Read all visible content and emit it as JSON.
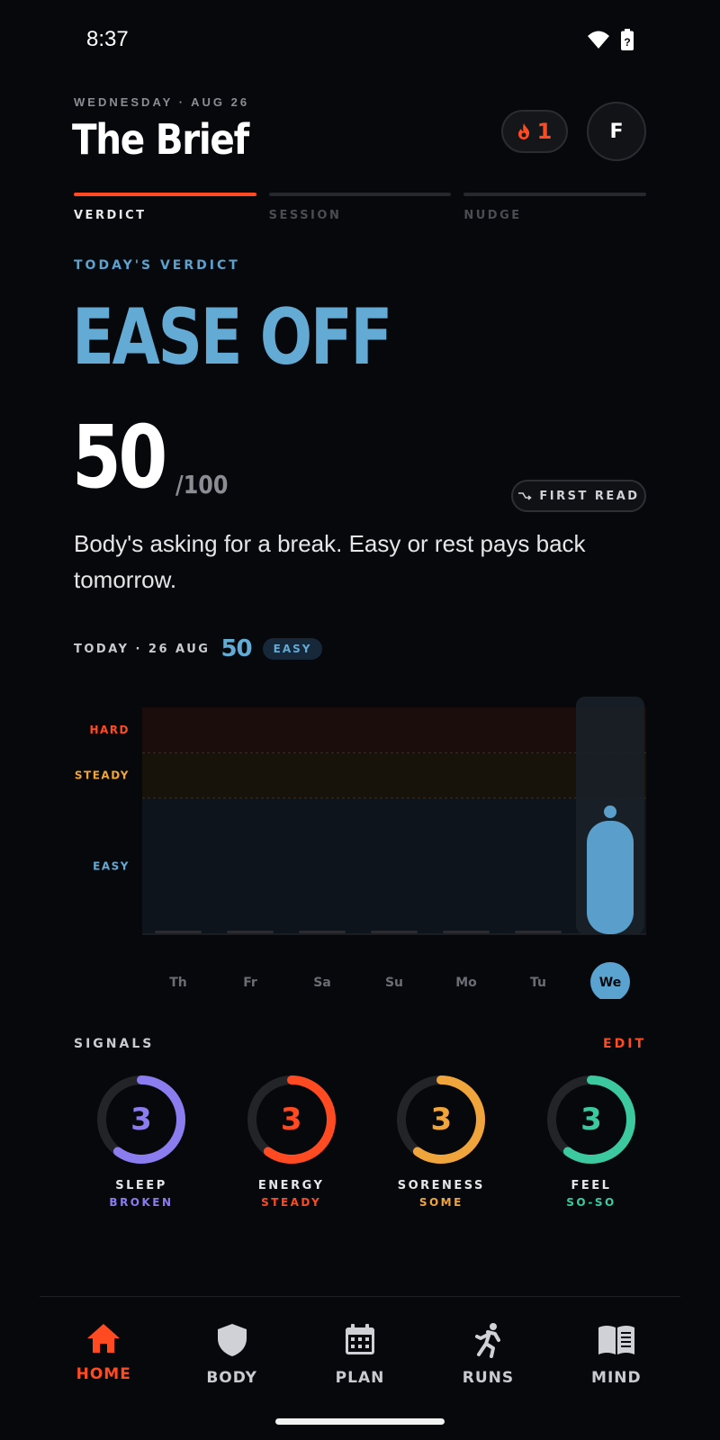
{
  "status": {
    "time": "8:37"
  },
  "header": {
    "date": "WEDNESDAY · AUG 26",
    "title": "The Brief",
    "streak_count": "1",
    "avatar_initial": "F"
  },
  "tabs": [
    {
      "label": "VERDICT",
      "active": true
    },
    {
      "label": "SESSION",
      "active": false
    },
    {
      "label": "NUDGE",
      "active": false
    }
  ],
  "verdict": {
    "label": "TODAY'S VERDICT",
    "headline": "EASE OFF",
    "score": "50",
    "score_max": "/100",
    "first_read_label": "FIRST READ",
    "summary": "Body's asking for a break. Easy or rest pays back tomorrow."
  },
  "today": {
    "label": "TODAY · 26 AUG",
    "score": "50",
    "pill": "EASY"
  },
  "chart_data": {
    "type": "bar",
    "categories": [
      "Th",
      "Fr",
      "Sa",
      "Su",
      "Mo",
      "Tu",
      "We"
    ],
    "values": [
      0,
      0,
      0,
      0,
      0,
      0,
      50
    ],
    "selected": "We",
    "ylim": [
      0,
      100
    ],
    "zones": [
      {
        "label": "HARD",
        "from": 80,
        "to": 100,
        "color": "#ff4a22"
      },
      {
        "label": "STEADY",
        "from": 60,
        "to": 80,
        "color": "#f0a53c"
      },
      {
        "label": "EASY",
        "from": 0,
        "to": 60,
        "color": "#63aad5"
      }
    ],
    "grid": false,
    "colors": {
      "bar": "#5a9fcb",
      "bar_empty": "#2a2c31"
    }
  },
  "signals": {
    "title": "SIGNALS",
    "edit_label": "EDIT",
    "items": [
      {
        "name": "SLEEP",
        "value": "3",
        "state": "BROKEN",
        "color": "#8b7df0",
        "fraction": 0.6
      },
      {
        "name": "ENERGY",
        "value": "3",
        "state": "STEADY",
        "color": "#ff4a22",
        "fraction": 0.6
      },
      {
        "name": "SORENESS",
        "value": "3",
        "state": "SOME",
        "color": "#f0a53c",
        "fraction": 0.6
      },
      {
        "name": "FEEL",
        "value": "3",
        "state": "SO-SO",
        "color": "#3cc9a0",
        "fraction": 0.6
      }
    ]
  },
  "nav": [
    {
      "label": "HOME",
      "icon": "home-icon",
      "active": true
    },
    {
      "label": "BODY",
      "icon": "shield-icon",
      "active": false
    },
    {
      "label": "PLAN",
      "icon": "calendar-icon",
      "active": false
    },
    {
      "label": "RUNS",
      "icon": "runner-icon",
      "active": false
    },
    {
      "label": "MIND",
      "icon": "book-icon",
      "active": false
    }
  ],
  "colors": {
    "accent": "#ff4a22",
    "verdict": "#63aad5",
    "bg": "#07080b"
  }
}
